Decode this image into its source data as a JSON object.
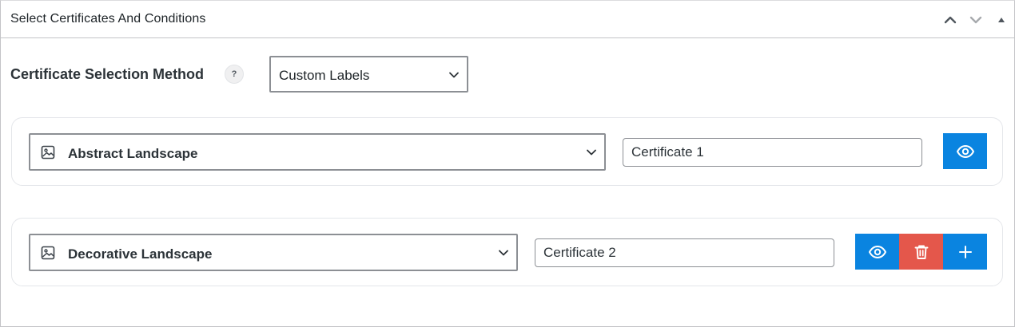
{
  "panel": {
    "title": "Select Certificates And Conditions",
    "controls": {
      "move_up_icon": "chevron-up-icon",
      "move_down_icon": "chevron-down-icon",
      "toggle_icon": "triangle-up-icon"
    }
  },
  "method": {
    "label": "Certificate Selection Method",
    "help": "?",
    "selected": "Custom Labels"
  },
  "rows": [
    {
      "template": "Abstract Landscape",
      "template_icon": "image-icon",
      "label_value": "Certificate 1",
      "actions": [
        "view"
      ]
    },
    {
      "template": "Decorative Landscape",
      "template_icon": "image-icon",
      "label_value": "Certificate 2",
      "actions": [
        "view",
        "delete",
        "add"
      ]
    }
  ],
  "colors": {
    "primary": "#0a84e0",
    "danger": "#e4574b",
    "border": "#8c8f94",
    "text": "#1d2327"
  }
}
